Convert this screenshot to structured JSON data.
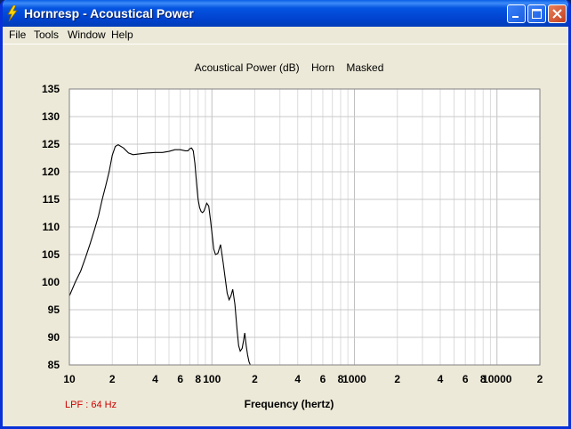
{
  "window": {
    "title": "Hornresp - Acoustical Power"
  },
  "menu": {
    "items": [
      "File",
      "Tools",
      "Window",
      "Help"
    ]
  },
  "chart_data": {
    "type": "line",
    "title": "Acoustical Power (dB)    Horn    Masked",
    "xlabel": "Frequency (hertz)",
    "ylabel": "",
    "x_scale": "log",
    "xlim": [
      10,
      20000
    ],
    "ylim": [
      85,
      135
    ],
    "y_ticks": [
      135,
      130,
      125,
      120,
      115,
      110,
      105,
      100,
      95,
      90,
      85
    ],
    "x_tick_labels": [
      {
        "value": 10,
        "label": "10"
      },
      {
        "value": 20,
        "label": "2"
      },
      {
        "value": 40,
        "label": "4"
      },
      {
        "value": 60,
        "label": "6"
      },
      {
        "value": 80,
        "label": "8"
      },
      {
        "value": 100,
        "label": "100"
      },
      {
        "value": 200,
        "label": "2"
      },
      {
        "value": 400,
        "label": "4"
      },
      {
        "value": 600,
        "label": "6"
      },
      {
        "value": 800,
        "label": "8"
      },
      {
        "value": 1000,
        "label": "1000"
      },
      {
        "value": 2000,
        "label": "2"
      },
      {
        "value": 4000,
        "label": "4"
      },
      {
        "value": 6000,
        "label": "6"
      },
      {
        "value": 8000,
        "label": "8"
      },
      {
        "value": 10000,
        "label": "10000"
      },
      {
        "value": 20000,
        "label": "2"
      }
    ],
    "grid": true,
    "annotation": "LPF : 64 Hz",
    "annotation_color": "#cc0000",
    "series": [
      {
        "x": [
          10,
          11,
          12,
          13,
          14,
          15,
          16,
          17,
          18,
          19,
          20,
          21,
          22,
          24,
          26,
          28,
          30,
          35,
          40,
          45,
          50,
          55,
          60,
          65,
          68,
          70,
          72,
          74,
          76,
          78,
          80,
          82,
          84,
          86,
          88,
          90,
          92,
          95,
          98,
          100,
          103,
          106,
          110,
          115,
          120,
          125,
          128,
          132,
          136,
          140,
          145,
          150,
          154,
          158,
          163,
          167,
          170,
          174,
          178,
          182,
          186,
          190,
          194,
          198,
          200
        ],
        "y": [
          97.5,
          100,
          102,
          104.5,
          107,
          109.5,
          112,
          115,
          117.5,
          120,
          123,
          124.6,
          124.9,
          124.3,
          123.4,
          123.1,
          123.2,
          123.4,
          123.5,
          123.5,
          123.7,
          124.0,
          124.0,
          123.8,
          123.8,
          124.2,
          124.3,
          123.8,
          121.5,
          118,
          115,
          113.5,
          112.8,
          112.6,
          112.9,
          113.6,
          114.3,
          113.8,
          111,
          109,
          106,
          105,
          105.2,
          106.8,
          103.5,
          100,
          98,
          96.8,
          97.5,
          98.7,
          96,
          91.5,
          88.5,
          87.5,
          88,
          89.5,
          90.8,
          88.5,
          86.8,
          85.6,
          85,
          84,
          83,
          82,
          81
        ]
      }
    ]
  }
}
